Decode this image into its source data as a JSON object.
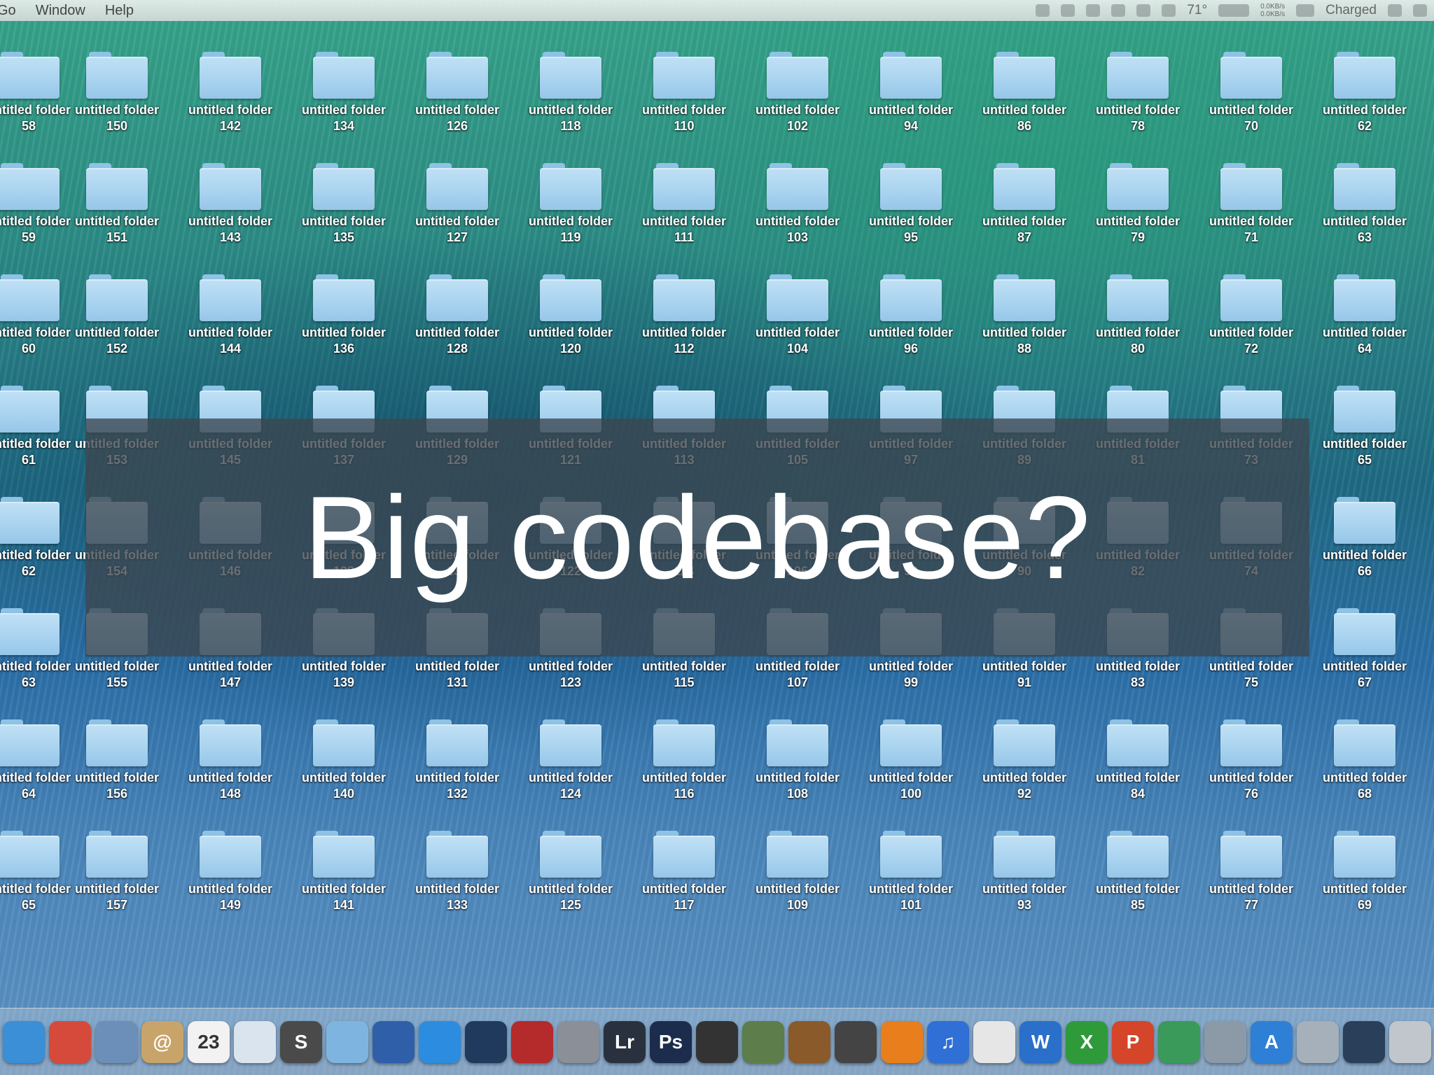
{
  "menubar": {
    "menus": [
      "Go",
      "Window",
      "Help"
    ],
    "temperature": "71°",
    "net_up": "0.0KB/s",
    "net_down": "0.0KB/s",
    "battery_status": "Charged"
  },
  "desktop": {
    "folder_name": "untitled folder",
    "columns": [
      {
        "numbers": [
          "58",
          "59",
          "60",
          "61",
          "62",
          "63",
          "64",
          "65"
        ]
      },
      {
        "numbers": [
          "150",
          "151",
          "152",
          "153",
          "154",
          "155",
          "156",
          "157"
        ]
      },
      {
        "numbers": [
          "142",
          "143",
          "144",
          "145",
          "146",
          "147",
          "148",
          "149"
        ]
      },
      {
        "numbers": [
          "134",
          "135",
          "136",
          "137",
          "138",
          "139",
          "140",
          "141"
        ]
      },
      {
        "numbers": [
          "126",
          "127",
          "128",
          "129",
          "130",
          "131",
          "132",
          "133"
        ]
      },
      {
        "numbers": [
          "118",
          "119",
          "120",
          "121",
          "122",
          "123",
          "124",
          "125"
        ]
      },
      {
        "numbers": [
          "110",
          "111",
          "112",
          "113",
          "114",
          "115",
          "116",
          "117"
        ]
      },
      {
        "numbers": [
          "102",
          "103",
          "104",
          "105",
          "106",
          "107",
          "108",
          "109"
        ]
      },
      {
        "numbers": [
          "94",
          "95",
          "96",
          "97",
          "98",
          "99",
          "100",
          "101"
        ]
      },
      {
        "numbers": [
          "86",
          "87",
          "88",
          "89",
          "90",
          "91",
          "92",
          "93"
        ]
      },
      {
        "numbers": [
          "78",
          "79",
          "80",
          "81",
          "82",
          "83",
          "84",
          "85"
        ]
      },
      {
        "numbers": [
          "70",
          "71",
          "72",
          "73",
          "74",
          "75",
          "76",
          "77"
        ]
      },
      {
        "numbers": [
          "62",
          "63",
          "64",
          "65",
          "66",
          "67",
          "68",
          "69"
        ]
      }
    ]
  },
  "overlay": {
    "title": "Big codebase?"
  },
  "dock": {
    "items": [
      {
        "icon": "finder-icon",
        "color": "#3b8fd6",
        "text": ""
      },
      {
        "icon": "chrome-icon",
        "color": "#d64a3b",
        "text": ""
      },
      {
        "icon": "mail-stamp-icon",
        "color": "#6b8fb8",
        "text": ""
      },
      {
        "icon": "contacts-icon",
        "color": "#c8a46a",
        "text": "@"
      },
      {
        "icon": "calendar-icon",
        "color": "#f2f2f2",
        "text": "23"
      },
      {
        "icon": "preview-icon",
        "color": "#d9e4ee",
        "text": ""
      },
      {
        "icon": "sublime-icon",
        "color": "#4a4a4a",
        "text": "S"
      },
      {
        "icon": "dropbox-folder-icon",
        "color": "#7eb5e0",
        "text": ""
      },
      {
        "icon": "virtualbox-icon",
        "color": "#2f5fa8",
        "text": ""
      },
      {
        "icon": "teamviewer-icon",
        "color": "#2c8de0",
        "text": ""
      },
      {
        "icon": "screenflow-icon",
        "color": "#1f3a5c",
        "text": ""
      },
      {
        "icon": "photo-booth-icon",
        "color": "#b52a2a",
        "text": ""
      },
      {
        "icon": "automator-icon",
        "color": "#8a8f98",
        "text": ""
      },
      {
        "icon": "lightroom-icon",
        "color": "#28313d",
        "text": "Lr"
      },
      {
        "icon": "photoshop-icon",
        "color": "#1c2c4c",
        "text": "Ps"
      },
      {
        "icon": "final-cut-icon",
        "color": "#333333",
        "text": ""
      },
      {
        "icon": "iphoto-icon",
        "color": "#5d7d4a",
        "text": ""
      },
      {
        "icon": "garageband-icon",
        "color": "#8a5a2a",
        "text": ""
      },
      {
        "icon": "disk-utility-icon",
        "color": "#444444",
        "text": ""
      },
      {
        "icon": "vlc-icon",
        "color": "#e87e1c",
        "text": ""
      },
      {
        "icon": "itunes-icon",
        "color": "#2f6fd6",
        "text": "♫"
      },
      {
        "icon": "textedit-icon",
        "color": "#e6e6e6",
        "text": ""
      },
      {
        "icon": "word-icon",
        "color": "#2a6fc9",
        "text": "W"
      },
      {
        "icon": "excel-icon",
        "color": "#2e9a3a",
        "text": "X"
      },
      {
        "icon": "powerpoint-icon",
        "color": "#d4452a",
        "text": "P"
      },
      {
        "icon": "network-globe-icon",
        "color": "#3a9a5a",
        "text": ""
      },
      {
        "icon": "directory-utility-icon",
        "color": "#8c9aa8",
        "text": ""
      },
      {
        "icon": "app-store-icon",
        "color": "#2e7fd6",
        "text": "A"
      },
      {
        "icon": "wireless-diagnostics-icon",
        "color": "#a6b0ba",
        "text": ""
      },
      {
        "icon": "activity-monitor-icon",
        "color": "#2a3f5a",
        "text": ""
      },
      {
        "icon": "trash-icon",
        "color": "#c0c6cc",
        "text": ""
      }
    ]
  }
}
